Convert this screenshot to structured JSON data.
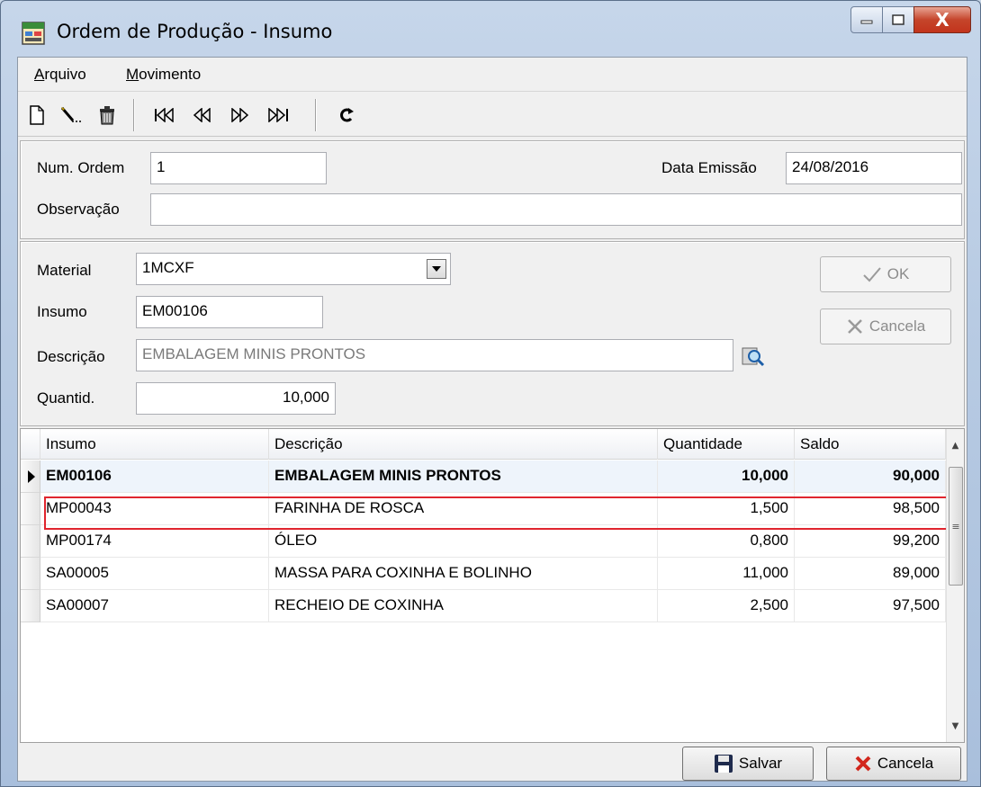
{
  "window": {
    "title": "Ordem de Produção - Insumo",
    "close_label": "X"
  },
  "menu": [
    {
      "label_first": "A",
      "label_rest": "rquivo"
    },
    {
      "label_first": "M",
      "label_rest": "ovimento"
    }
  ],
  "toolbar": {
    "icons": [
      "new-icon",
      "edit-icon",
      "delete-icon",
      "first-icon",
      "prev-icon",
      "next-icon",
      "last-icon",
      "refresh-icon"
    ]
  },
  "header": {
    "num_ordem_label": "Num. Ordem",
    "num_ordem_value": "1",
    "data_emissao_label": "Data Emissão",
    "data_emissao_value": "24/08/2016",
    "observacao_label": "Observação",
    "observacao_value": ""
  },
  "item": {
    "material_label": "Material",
    "material_value": "1MCXF",
    "insumo_label": "Insumo",
    "insumo_value": "EM00106",
    "descricao_label": "Descrição",
    "descricao_value": "EMBALAGEM MINIS PRONTOS",
    "quantid_label": "Quantid.",
    "quantid_value": "10,000",
    "ok_label": "OK",
    "cancela_label": "Cancela"
  },
  "grid": {
    "columns": [
      "Insumo",
      "Descrição",
      "Quantidade",
      "Saldo"
    ],
    "rows": [
      {
        "insumo": "EM00106",
        "descricao": "EMBALAGEM MINIS PRONTOS",
        "quantidade": "10,000",
        "saldo": "90,000"
      },
      {
        "insumo": "MP00043",
        "descricao": "FARINHA DE ROSCA",
        "quantidade": "1,500",
        "saldo": "98,500"
      },
      {
        "insumo": "MP00174",
        "descricao": "ÓLEO",
        "quantidade": "0,800",
        "saldo": "99,200"
      },
      {
        "insumo": "SA00005",
        "descricao": "MASSA PARA COXINHA E BOLINHO",
        "quantidade": "11,000",
        "saldo": "89,000"
      },
      {
        "insumo": "SA00007",
        "descricao": "RECHEIO DE COXINHA",
        "quantidade": "2,500",
        "saldo": "97,500"
      }
    ],
    "highlight_color": "#e0252e"
  },
  "footer": {
    "salvar_label": "Salvar",
    "cancela_label": "Cancela"
  }
}
